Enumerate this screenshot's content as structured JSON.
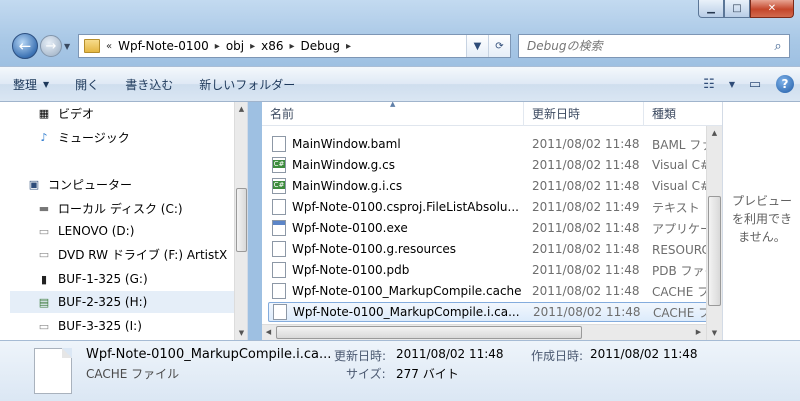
{
  "window": {
    "caption_buttons": [
      "minimize",
      "maximize",
      "close"
    ]
  },
  "nav": {
    "back_icon": "back-arrow-icon",
    "forward_icon": "forward-arrow-icon",
    "breadcrumb": [
      "Wpf-Note-0100",
      "obj",
      "x86",
      "Debug"
    ],
    "breadcrumb_prefix": "«",
    "search_placeholder": "Debugの検索"
  },
  "toolbar": {
    "organize": "整理",
    "open": "開く",
    "burn": "書き込む",
    "new_folder": "新しいフォルダー"
  },
  "navpane": {
    "items": [
      {
        "label": "ビデオ",
        "icon": "video-icon"
      },
      {
        "label": "ミュージック",
        "icon": "music-icon"
      },
      {
        "label": "コンピューター",
        "icon": "computer-icon"
      },
      {
        "label": "ローカル ディスク (C:)",
        "icon": "local-disk-icon"
      },
      {
        "label": "LENOVO (D:)",
        "icon": "drive-icon"
      },
      {
        "label": "DVD RW ドライブ (F:) ArtistX",
        "icon": "dvd-drive-icon"
      },
      {
        "label": "BUF-1-325 (G:)",
        "icon": "external-drive-icon"
      },
      {
        "label": "BUF-2-325 (H:)",
        "icon": "network-drive-icon"
      },
      {
        "label": "BUF-3-325 (I:)",
        "icon": "drive-icon"
      }
    ]
  },
  "files": {
    "columns": {
      "name": "名前",
      "date": "更新日時",
      "type": "種類"
    },
    "rows": [
      {
        "name": "MainWindow.baml",
        "date": "2011/08/02 11:48",
        "type": "BAML ファイル",
        "icon": "file"
      },
      {
        "name": "MainWindow.g.cs",
        "date": "2011/08/02 11:48",
        "type": "Visual C# Source",
        "icon": "cs"
      },
      {
        "name": "MainWindow.g.i.cs",
        "date": "2011/08/02 11:48",
        "type": "Visual C# Source",
        "icon": "cs"
      },
      {
        "name": "Wpf-Note-0100.csproj.FileListAbsolu...",
        "date": "2011/08/02 11:49",
        "type": "テキスト ドキュメント",
        "icon": "file"
      },
      {
        "name": "Wpf-Note-0100.exe",
        "date": "2011/08/02 11:48",
        "type": "アプリケーション",
        "icon": "exe"
      },
      {
        "name": "Wpf-Note-0100.g.resources",
        "date": "2011/08/02 11:48",
        "type": "RESOURCES ファイル",
        "icon": "file"
      },
      {
        "name": "Wpf-Note-0100.pdb",
        "date": "2011/08/02 11:48",
        "type": "PDB ファイル",
        "icon": "file"
      },
      {
        "name": "Wpf-Note-0100_MarkupCompile.cache",
        "date": "2011/08/02 11:48",
        "type": "CACHE ファイル",
        "icon": "file"
      },
      {
        "name": "Wpf-Note-0100_MarkupCompile.i.ca...",
        "date": "2011/08/02 11:48",
        "type": "CACHE ファイル",
        "icon": "file",
        "selected": true
      }
    ]
  },
  "preview": {
    "text": "プレビューを利用できません。"
  },
  "details": {
    "filename": "Wpf-Note-0100_MarkupCompile.i.ca...",
    "filetype": "CACHE ファイル",
    "modified_label": "更新日時:",
    "modified_value": "2011/08/02 11:48",
    "created_label": "作成日時:",
    "created_value": "2011/08/02 11:48",
    "size_label": "サイズ:",
    "size_value": "277 バイト"
  }
}
